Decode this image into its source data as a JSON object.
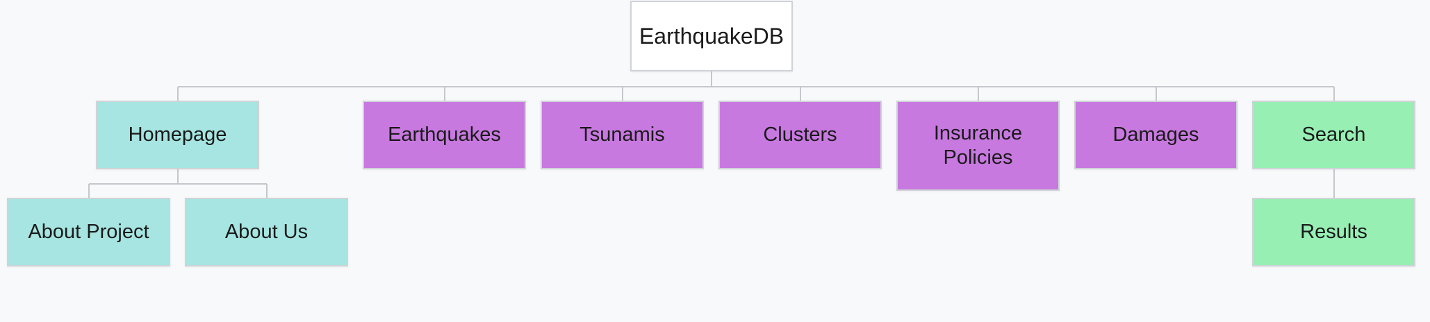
{
  "diagram": {
    "root": {
      "label": "EarthquakeDB"
    },
    "homepage": {
      "label": "Homepage"
    },
    "earthquakes": {
      "label": "Earthquakes"
    },
    "tsunamis": {
      "label": "Tsunamis"
    },
    "clusters": {
      "label": "Clusters"
    },
    "insurance": {
      "label_line1": "Insurance",
      "label_line2": "Policies"
    },
    "damages": {
      "label": "Damages"
    },
    "search": {
      "label": "Search"
    },
    "about_project": {
      "label": "About Project"
    },
    "about_us": {
      "label": "About Us"
    },
    "results": {
      "label": "Results"
    }
  },
  "colors": {
    "background": "#f8f9fb",
    "root": "#ffffff",
    "teal": "#a6e5e1",
    "purple": "#c879e0",
    "green": "#97efb4",
    "connector": "#c4c8cc"
  }
}
